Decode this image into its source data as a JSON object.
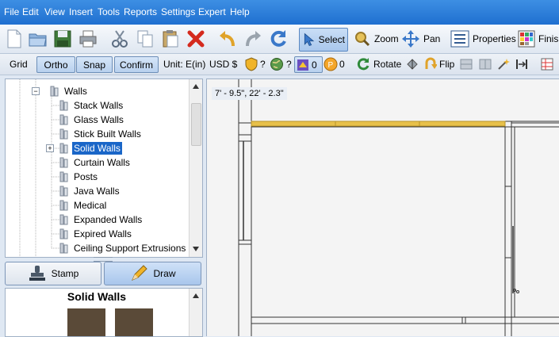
{
  "menu": [
    "File",
    "Edit",
    "View",
    "Insert",
    "Tools",
    "Reports",
    "Settings",
    "Expert",
    "Help"
  ],
  "toolbar": {
    "select_label": "Select",
    "zoom_label": "Zoom",
    "pan_label": "Pan",
    "properties_label": "Properties",
    "finish_label": "Finish"
  },
  "optbar": {
    "grid_label": "Grid",
    "ortho_label": "Ortho",
    "snap_label": "Snap",
    "confirm_label": "Confirm",
    "unit_label": "Unit: E(in)",
    "currency_label": "USD $",
    "q1": "?",
    "q2": "?",
    "count1": "0",
    "count2": "0",
    "rotate_label": "Rotate",
    "flip_label": "Flip"
  },
  "tree": {
    "parent": "Walls",
    "items": [
      "Stack Walls",
      "Glass Walls",
      "Stick Built Walls",
      "Solid Walls",
      "Curtain Walls",
      "Posts",
      "Java Walls",
      "Medical",
      "Expanded Walls",
      "Expired Walls",
      "Ceiling Support Extrusions"
    ],
    "selected": "Solid Walls"
  },
  "drawbar": {
    "stamp_label": "Stamp",
    "draw_label": "Draw"
  },
  "preview": {
    "title": "Solid Walls",
    "swatch_color": "#5a4a38"
  },
  "canvas": {
    "coordinates": "7' - 9.5\", 22' - 2.3\""
  },
  "colors": {
    "menubar": "#2a7bd9",
    "selection": "#1a66c8",
    "highlight_wall": "#e8c14a"
  }
}
